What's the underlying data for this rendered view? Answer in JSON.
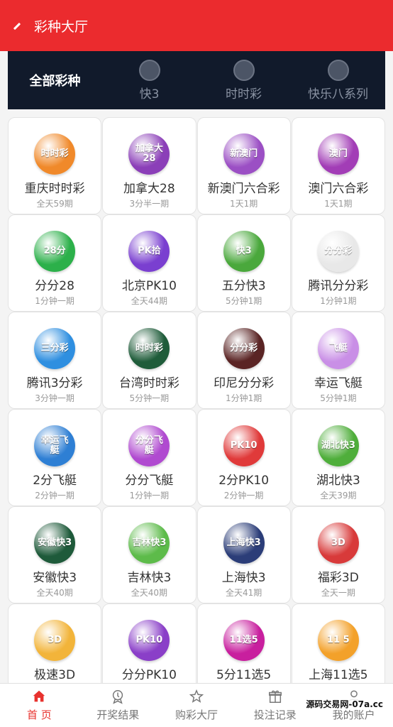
{
  "header": {
    "title": "彩种大厅"
  },
  "colors": {
    "header_bg": "#eb2b2e",
    "tabs_bg": "#111a2b",
    "active_nav": "#e8322e"
  },
  "categories": [
    {
      "label": "全部彩种",
      "active": true,
      "icon": ""
    },
    {
      "label": "快3",
      "active": false,
      "icon": "dice-badge-icon"
    },
    {
      "label": "时时彩",
      "active": false,
      "icon": "ssc-badge-icon"
    },
    {
      "label": "快乐八系列",
      "active": false,
      "icon": "happy8-badge-icon"
    }
  ],
  "lotteries": [
    {
      "name": "重庆时时彩",
      "period": "全天59期",
      "logo_text": "时时彩",
      "color": "#f0892a"
    },
    {
      "name": "加拿大28",
      "period": "3分半一期",
      "logo_text": "加拿大28",
      "color": "#8b3fb8"
    },
    {
      "name": "新澳门六合彩",
      "period": "1天1期",
      "logo_text": "新澳门",
      "color": "#9b4fc4"
    },
    {
      "name": "澳门六合彩",
      "period": "1天1期",
      "logo_text": "澳门",
      "color": "#a23db6"
    },
    {
      "name": "分分28",
      "period": "1分钟一期",
      "logo_text": "28分",
      "color": "#2cb04a"
    },
    {
      "name": "北京PK10",
      "period": "全天44期",
      "logo_text": "PK拾",
      "color": "#7a3fd0"
    },
    {
      "name": "五分快3",
      "period": "5分钟1期",
      "logo_text": "快3",
      "color": "#4aa83c"
    },
    {
      "name": "腾讯分分彩",
      "period": "1分钟1期",
      "logo_text": "分分彩",
      "color": "#e8e8e8"
    },
    {
      "name": "腾讯3分彩",
      "period": "3分钟一期",
      "logo_text": "三分彩",
      "color": "#2f8fe0"
    },
    {
      "name": "台湾时时彩",
      "period": "5分钟一期",
      "logo_text": "时时彩",
      "color": "#1f5c3a"
    },
    {
      "name": "印尼分分彩",
      "period": "1分钟1期",
      "logo_text": "分分彩",
      "color": "#5a2424"
    },
    {
      "name": "幸运飞艇",
      "period": "5分钟1期",
      "logo_text": "飞艇",
      "color": "#c98fe6"
    },
    {
      "name": "2分飞艇",
      "period": "2分钟一期",
      "logo_text": "幸运飞艇",
      "color": "#2e7fd4"
    },
    {
      "name": "分分飞艇",
      "period": "1分钟一期",
      "logo_text": "分分飞艇",
      "color": "#b04ad0"
    },
    {
      "name": "2分PK10",
      "period": "2分钟一期",
      "logo_text": "PK10",
      "color": "#e03a3a"
    },
    {
      "name": "湖北快3",
      "period": "全天39期",
      "logo_text": "湖北快3",
      "color": "#4fae3b"
    },
    {
      "name": "安徽快3",
      "period": "全天40期",
      "logo_text": "安徽快3",
      "color": "#1e5a3a"
    },
    {
      "name": "吉林快3",
      "period": "全天40期",
      "logo_text": "吉林快3",
      "color": "#5dbb4a"
    },
    {
      "name": "上海快3",
      "period": "全天41期",
      "logo_text": "上海快3",
      "color": "#2b3d78"
    },
    {
      "name": "福彩3D",
      "period": "全天一期",
      "logo_text": "3D",
      "color": "#d83a3a"
    },
    {
      "name": "极速3D",
      "period": "",
      "logo_text": "3D",
      "color": "#f2b43a"
    },
    {
      "name": "分分PK10",
      "period": "",
      "logo_text": "PK10",
      "color": "#8a3fc8"
    },
    {
      "name": "5分11选5",
      "period": "",
      "logo_text": "11选5",
      "color": "#c81f9e"
    },
    {
      "name": "上海11选5",
      "period": "",
      "logo_text": "11 5",
      "color": "#f3a12a"
    }
  ],
  "bottom_nav": [
    {
      "label": "首 页",
      "icon": "home-icon",
      "active": true
    },
    {
      "label": "开奖结果",
      "icon": "award-icon",
      "active": false
    },
    {
      "label": "购彩大厅",
      "icon": "star-icon",
      "active": false
    },
    {
      "label": "投注记录",
      "icon": "gift-icon",
      "active": false
    },
    {
      "label": "我的账户",
      "icon": "user-icon",
      "active": false
    }
  ],
  "watermark": "源码交易网-07a.cc"
}
